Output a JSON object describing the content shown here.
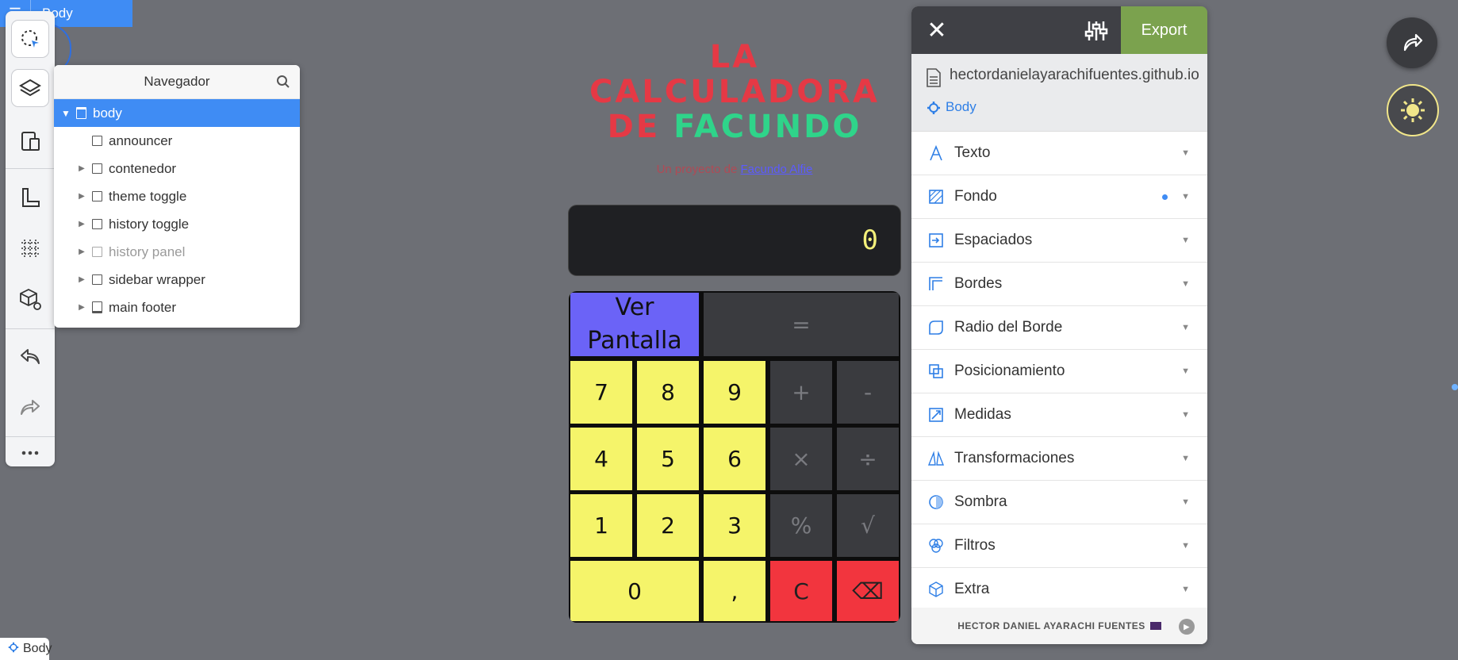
{
  "top_tag": {
    "label": "Body"
  },
  "navigator": {
    "title": "Navegador",
    "items": [
      {
        "label": "body",
        "expanded": true,
        "selected": true
      },
      {
        "label": "announcer"
      },
      {
        "label": "contenedor"
      },
      {
        "label": "theme toggle"
      },
      {
        "label": "history toggle"
      },
      {
        "label": "history panel",
        "dimmed": true
      },
      {
        "label": "sidebar wrapper"
      },
      {
        "label": "main footer"
      }
    ]
  },
  "page": {
    "title_line1": "LA",
    "title_line2": "CALCULADORA",
    "title_line3_a": "DE ",
    "title_line3_b": "FACUNDO",
    "subtitle_prefix": "Un proyecto de",
    "subtitle_link": "Facundo Alfie",
    "display_value": "0",
    "keys": {
      "ver_pantalla_1": "Ver",
      "ver_pantalla_2": "Pantalla",
      "equals": "=",
      "k7": "7",
      "k8": "8",
      "k9": "9",
      "plus": "+",
      "minus": "-",
      "k4": "4",
      "k5": "5",
      "k6": "6",
      "times": "×",
      "divide": "÷",
      "k1": "1",
      "k2": "2",
      "k3": "3",
      "percent": "%",
      "sqrt": "√",
      "k0": "0",
      "comma": ",",
      "clear": "C",
      "backspace": "⌫"
    }
  },
  "panel": {
    "export_label": "Export",
    "url": "hectordanielayarachifuentes.github.io",
    "element": "Body",
    "sections": [
      {
        "label": "Texto",
        "icon": "text-icon"
      },
      {
        "label": "Fondo",
        "icon": "background-icon",
        "modified": true
      },
      {
        "label": "Espaciados",
        "icon": "spacing-icon"
      },
      {
        "label": "Bordes",
        "icon": "borders-icon"
      },
      {
        "label": "Radio del Borde",
        "icon": "border-radius-icon"
      },
      {
        "label": "Posicionamiento",
        "icon": "positioning-icon"
      },
      {
        "label": "Medidas",
        "icon": "measures-icon"
      },
      {
        "label": "Transformaciones",
        "icon": "transform-icon"
      },
      {
        "label": "Sombra",
        "icon": "shadow-icon"
      },
      {
        "label": "Filtros",
        "icon": "filters-icon"
      },
      {
        "label": "Extra",
        "icon": "extra-icon"
      }
    ],
    "footer": "HECTOR DANIEL AYARACHI FUENTES"
  },
  "bottom_tag": {
    "label": "Body"
  },
  "colors": {
    "accent": "#3f8cf4",
    "export_green": "#7ba24e",
    "title_red": "#e53945",
    "title_green": "#2fd48a",
    "key_yellow": "#f5f46a",
    "key_red": "#f2353e",
    "key_blue": "#6b63f7"
  }
}
